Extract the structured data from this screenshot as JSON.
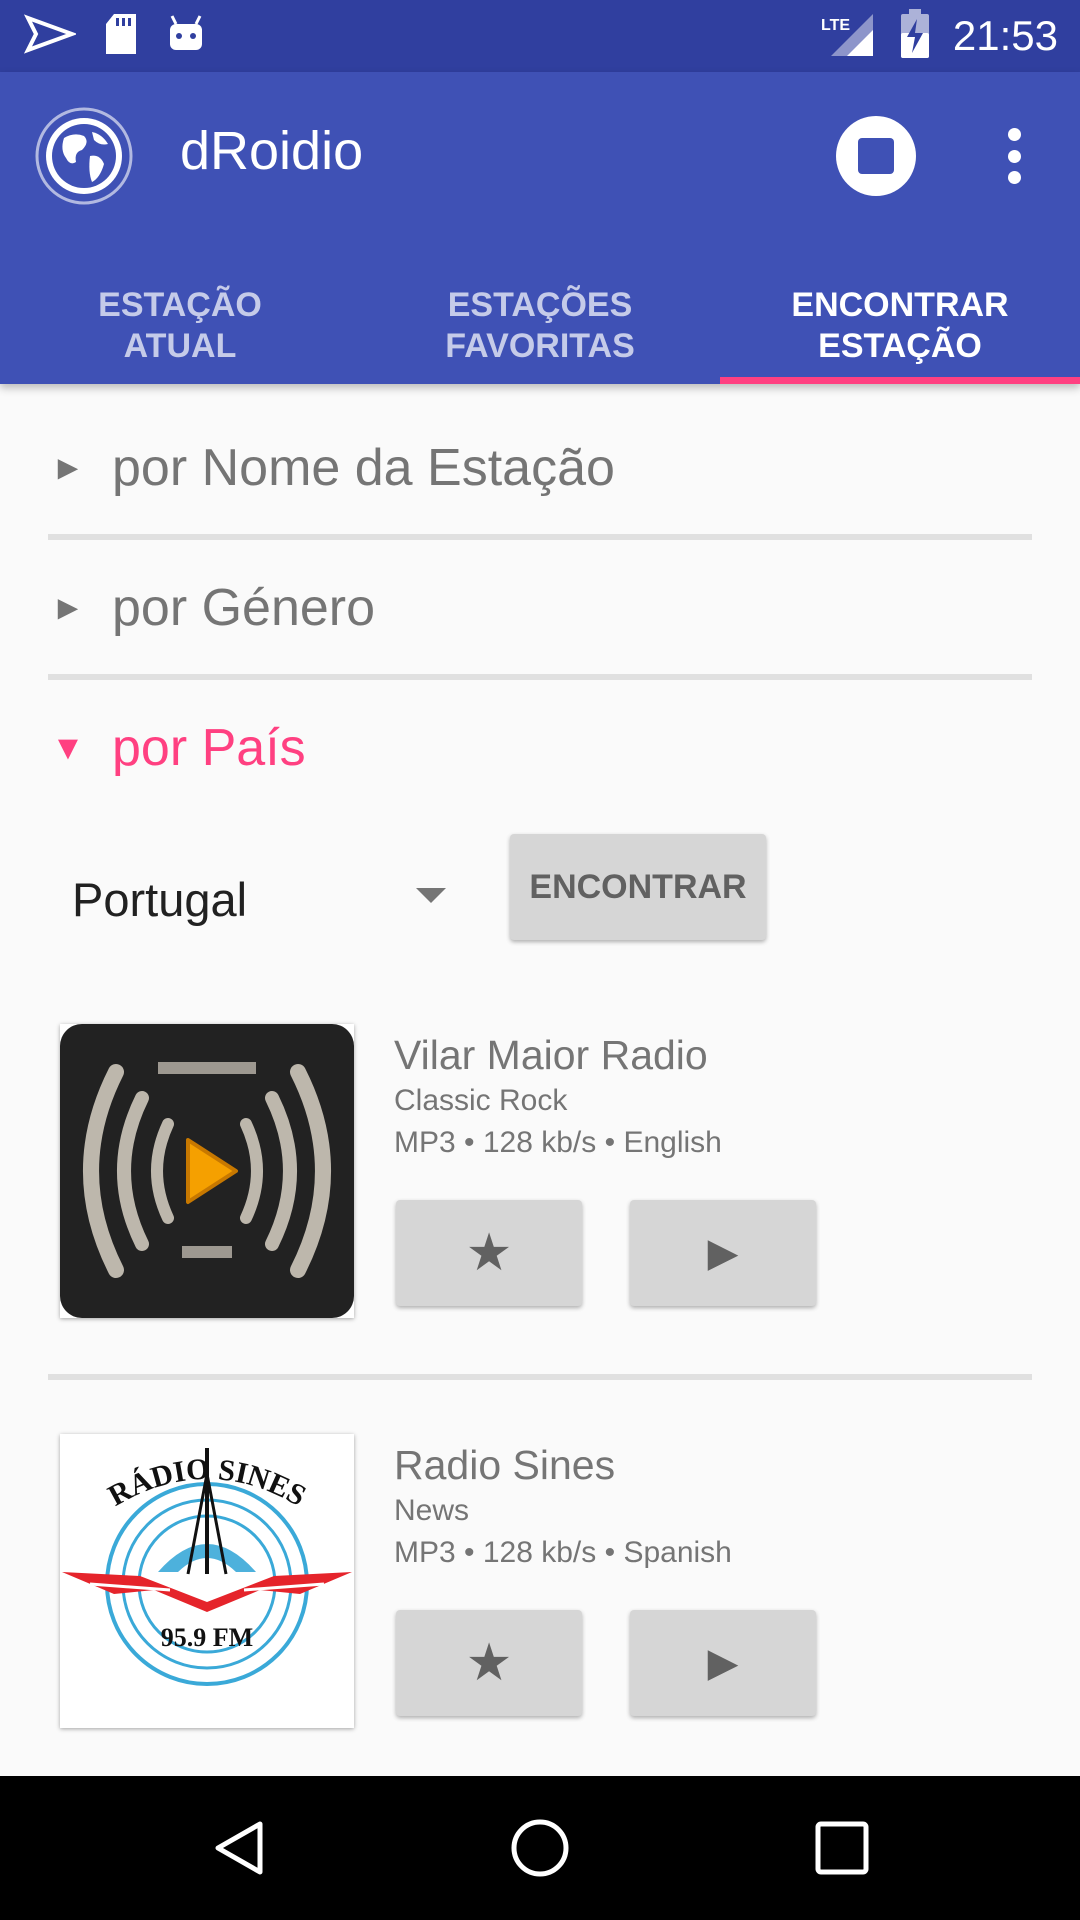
{
  "status_bar": {
    "time": "21:53",
    "network": "LTE",
    "icons": [
      "play-store-notification-icon",
      "sd-card-icon",
      "android-debug-icon",
      "lte-signal-icon",
      "battery-charging-icon"
    ]
  },
  "app_bar": {
    "title": "dRoidio",
    "logo_icon": "globe-icon",
    "actions": [
      "stop-icon",
      "overflow-menu-icon"
    ]
  },
  "tabs": [
    {
      "label": "ESTAÇÃO\nATUAL",
      "active": false
    },
    {
      "label": "ESTAÇÕES\nFAVORITAS",
      "active": false
    },
    {
      "label": "ENCONTRAR\nESTAÇÃO",
      "active": true
    }
  ],
  "search": {
    "sections": [
      {
        "label": "por Nome da Estação",
        "expanded": false
      },
      {
        "label": "por Género",
        "expanded": false
      },
      {
        "label": "por País",
        "expanded": true
      }
    ],
    "country_selected": "Portugal",
    "find_button": "ENCONTRAR"
  },
  "stations": [
    {
      "name": "Vilar Maior Radio",
      "genre": "Classic Rock",
      "meta": "MP3 • 128 kb/s • English",
      "logo": "radio-waves-play-logo"
    },
    {
      "name": "Radio Sines",
      "genre": "News",
      "meta": "MP3 • 128 kb/s • Spanish",
      "logo": "radio-sines-logo",
      "logo_text": "RÁDIO SINES 95.9 FM"
    }
  ],
  "station_actions": {
    "favorite_icon": "star-icon",
    "play_icon": "play-icon"
  },
  "nav_bar": [
    "back-icon",
    "home-icon",
    "recents-icon"
  ],
  "colors": {
    "primary": "#3f51b5",
    "primary_dark": "#303f9f",
    "accent": "#ff4081",
    "button_bg": "#d6d6d6"
  }
}
